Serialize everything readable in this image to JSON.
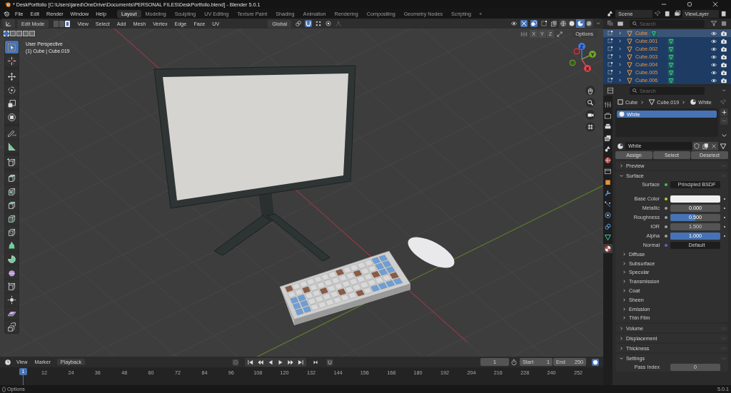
{
  "window": {
    "title": "* DeskPortfolio [C:\\Users\\jared\\OneDrive\\Documents\\PERSONAL FILES\\DeskPortfolio.blend] - Blender 5.0.1"
  },
  "menu": [
    "File",
    "Edit",
    "Render",
    "Window",
    "Help"
  ],
  "workspaces": [
    {
      "label": "Layout",
      "selected": true
    },
    {
      "label": "Modeling",
      "selected": false
    },
    {
      "label": "Sculpting",
      "selected": false
    },
    {
      "label": "UV Editing",
      "selected": false
    },
    {
      "label": "Texture Paint",
      "selected": false
    },
    {
      "label": "Shading",
      "selected": false
    },
    {
      "label": "Animation",
      "selected": false
    },
    {
      "label": "Rendering",
      "selected": false
    },
    {
      "label": "Compositing",
      "selected": false
    },
    {
      "label": "Geometry Nodes",
      "selected": false
    },
    {
      "label": "Scripting",
      "selected": false
    }
  ],
  "add_workspace": "+",
  "scene": {
    "name": "Scene"
  },
  "view_layer": {
    "name": "ViewLayer"
  },
  "viewport": {
    "mode": "Edit Mode",
    "select_modes": [
      {
        "selected": false
      },
      {
        "selected": false
      },
      {
        "selected": true
      }
    ],
    "menus": [
      "View",
      "Select",
      "Add",
      "Mesh",
      "Vertex",
      "Edge",
      "Face",
      "UV"
    ],
    "orientation": "Global",
    "shading": [
      {
        "selected": false
      },
      {
        "selected": false
      },
      {
        "selected": true
      },
      {
        "selected": false
      }
    ],
    "box_modes": [
      {
        "selected": true
      },
      {
        "selected": false
      },
      {
        "selected": false
      },
      {
        "selected": false
      },
      {
        "selected": false
      }
    ],
    "axes": [
      "X",
      "Y",
      "Z"
    ],
    "options": "Options",
    "view_name": "User Perspective",
    "object_info": "(1) Cube | Cube.019",
    "gizmo": [
      "Z",
      "Y",
      "X"
    ]
  },
  "tools": [
    {
      "selected": true
    },
    {
      "selected": false
    },
    {
      "selected": false
    },
    {
      "selected": false
    },
    {
      "selected": false
    },
    {
      "selected": false
    },
    {
      "selected": false
    },
    {
      "selected": false
    },
    {
      "selected": false
    },
    {
      "selected": false
    },
    {
      "selected": false
    },
    {
      "selected": false
    },
    {
      "selected": false
    },
    {
      "selected": false
    },
    {
      "selected": false
    },
    {
      "selected": false
    },
    {
      "selected": false
    },
    {
      "selected": false
    },
    {
      "selected": false
    },
    {
      "selected": false
    },
    {
      "selected": false
    }
  ],
  "outliner": {
    "search": {
      "placeholder": "Search"
    },
    "rows": [
      {
        "name": "Cube",
        "selected": true,
        "active": true
      },
      {
        "name": "Cube.001",
        "selected": true,
        "active": false
      },
      {
        "name": "Cube.002",
        "selected": true,
        "active": false
      },
      {
        "name": "Cube.003",
        "selected": true,
        "active": false
      },
      {
        "name": "Cube.004",
        "selected": true,
        "active": false
      },
      {
        "name": "Cube.005",
        "selected": true,
        "active": false
      },
      {
        "name": "Cube.006",
        "selected": true,
        "active": false
      }
    ]
  },
  "properties": {
    "search": {
      "placeholder": "Search"
    },
    "tabs": [
      {
        "selected": false
      },
      {
        "selected": false
      },
      {
        "selected": false
      },
      {
        "selected": false
      },
      {
        "selected": false
      },
      {
        "selected": false
      },
      {
        "selected": false
      },
      {
        "selected": false
      },
      {
        "selected": false
      },
      {
        "selected": false
      },
      {
        "selected": false
      },
      {
        "selected": false
      },
      {
        "selected": false
      },
      {
        "selected": true
      }
    ],
    "breadcrumb": [
      "Cube",
      "Cube.019",
      "White"
    ],
    "slots": [
      {
        "name": "White",
        "selected": true
      }
    ],
    "material": "White",
    "buttons": [
      "Assign",
      "Select",
      "Deselect"
    ],
    "panels": [
      {
        "label": "Preview",
        "expanded": false
      },
      {
        "label": "Surface",
        "expanded": true,
        "fields": [
          {
            "kind": "shader",
            "label": "Surface",
            "value": "Principled BSDF",
            "color": "#3cc94b"
          },
          {
            "kind": "color",
            "label": "Base Color",
            "color": "#c7c729"
          },
          {
            "kind": "slider",
            "label": "Metallic",
            "value": "0.000",
            "color": "#a1a1a1"
          },
          {
            "kind": "slider",
            "label": "Roughness",
            "value": "0.500",
            "level": 0.5,
            "color": "#a1a1a1"
          },
          {
            "kind": "number",
            "label": "IOR",
            "value": "1.500",
            "color": "#a1a1a1"
          },
          {
            "kind": "slider",
            "label": "Alpha",
            "value": "1.000",
            "level": 1,
            "color": "#a1a1a1"
          },
          {
            "kind": "vector",
            "label": "Normal",
            "value": "Default",
            "color": "#6363c7"
          }
        ],
        "subpanels": [
          {
            "label": "Diffuse",
            "expanded": false
          },
          {
            "label": "Subsurface",
            "expanded": false
          },
          {
            "label": "Specular",
            "expanded": false
          },
          {
            "label": "Transmission",
            "expanded": false
          },
          {
            "label": "Coat",
            "expanded": false
          },
          {
            "label": "Sheen",
            "expanded": false
          },
          {
            "label": "Emission",
            "expanded": false
          },
          {
            "label": "Thin Film",
            "expanded": false
          }
        ]
      },
      {
        "label": "Volume",
        "expanded": false
      },
      {
        "label": "Displacement",
        "expanded": false
      },
      {
        "label": "Thickness",
        "expanded": false
      },
      {
        "label": "Settings",
        "expanded": true,
        "fields": [
          {
            "kind": "number",
            "label": "Pass Index",
            "value": "0"
          }
        ]
      }
    ]
  },
  "timeline": {
    "menus": [
      "View",
      "Marker",
      "Playback"
    ],
    "current_frame": "1",
    "start_label": "Start",
    "start": "1",
    "end_label": "End",
    "end": "250",
    "playhead": "1",
    "ticks": [
      "12",
      "24",
      "36",
      "48",
      "60",
      "72",
      "84",
      "96",
      "108",
      "120",
      "132",
      "144",
      "156",
      "168",
      "180",
      "192",
      "204",
      "216",
      "228",
      "240",
      "252"
    ]
  },
  "status_bar": {
    "left": "Options",
    "version": "5.0.1"
  }
}
